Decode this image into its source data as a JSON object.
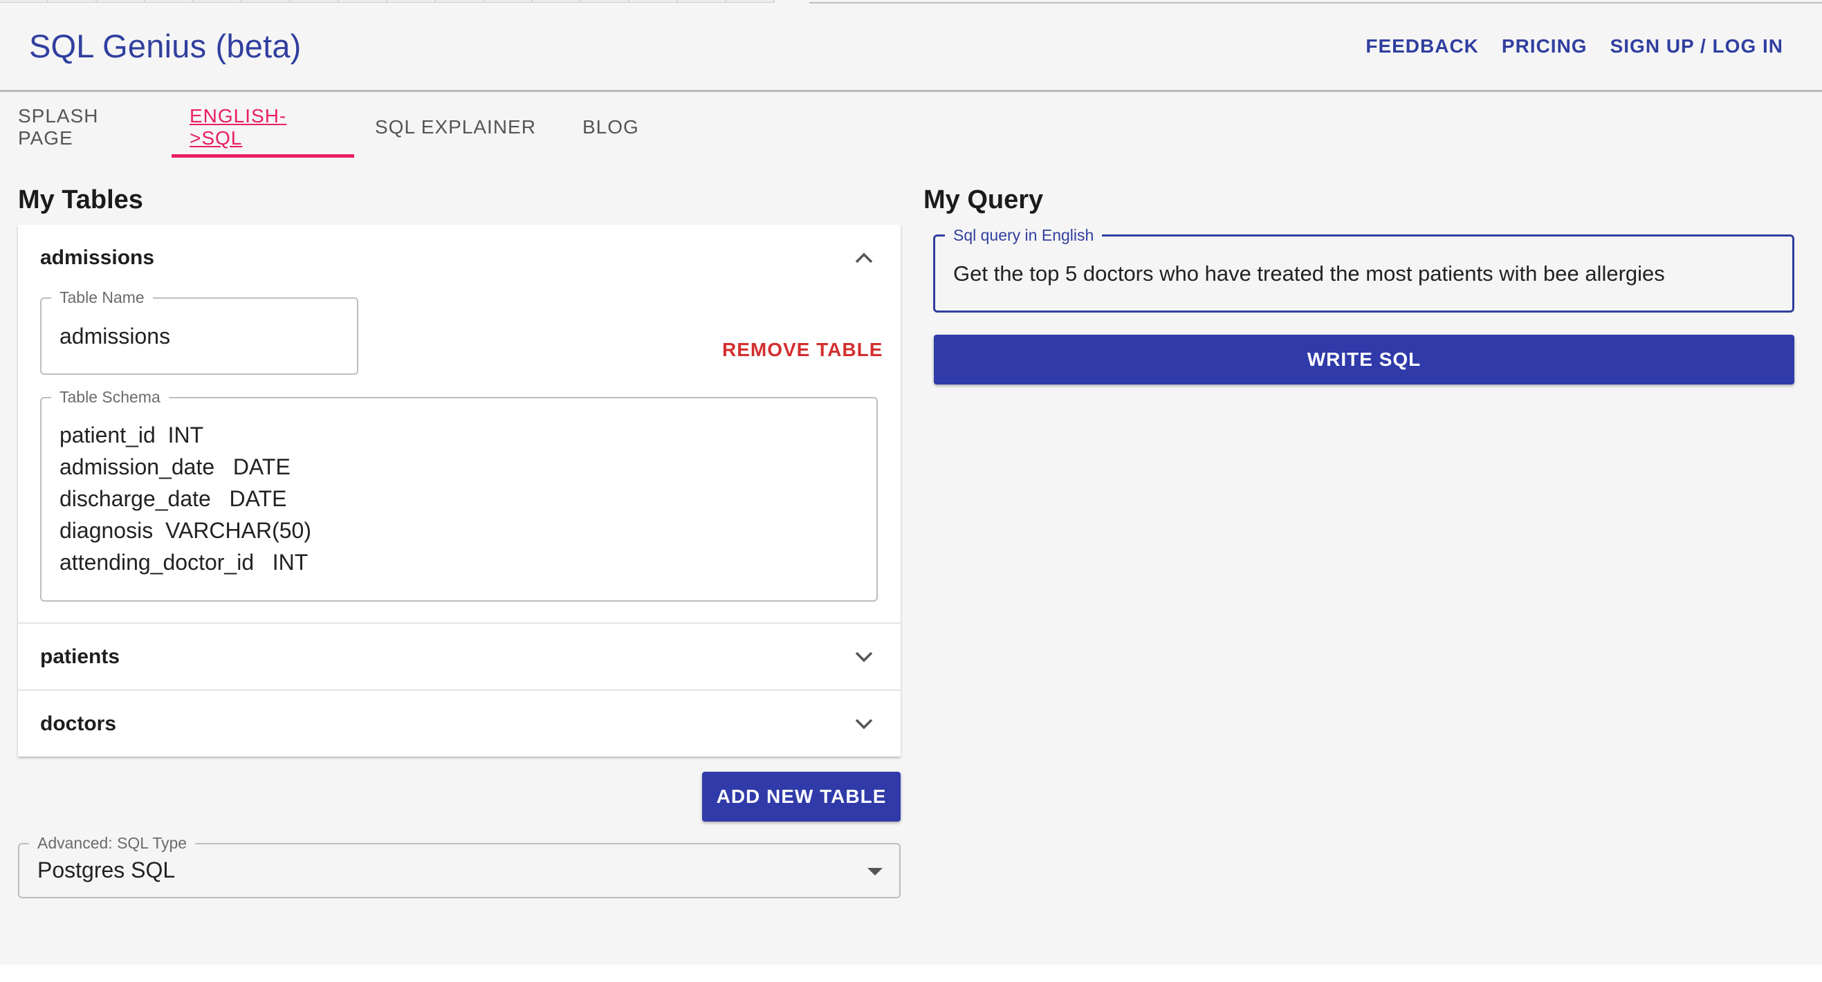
{
  "app": {
    "title": "SQL Genius (beta)"
  },
  "header_nav": [
    {
      "label": "FEEDBACK"
    },
    {
      "label": "PRICING"
    },
    {
      "label": "SIGN UP / LOG IN"
    }
  ],
  "tabs": [
    {
      "label": "SPLASH PAGE",
      "active": false
    },
    {
      "label": "ENGLISH->SQL",
      "active": true
    },
    {
      "label": "SQL EXPLAINER",
      "active": false
    },
    {
      "label": "BLOG",
      "active": false
    }
  ],
  "tables_section": {
    "title": "My Tables",
    "tables": [
      {
        "name": "admissions",
        "expanded": true,
        "name_field_label": "Table Name",
        "name_value": "admissions",
        "remove_label": "REMOVE TABLE",
        "schema_field_label": "Table Schema",
        "schema_lines": [
          "patient_id  INT",
          "admission_date   DATE",
          "discharge_date   DATE",
          "diagnosis  VARCHAR(50)",
          "attending_doctor_id   INT"
        ]
      },
      {
        "name": "patients",
        "expanded": false
      },
      {
        "name": "doctors",
        "expanded": false
      }
    ],
    "add_table_label": "ADD NEW TABLE",
    "sql_type": {
      "label": "Advanced: SQL Type",
      "value": "Postgres SQL"
    }
  },
  "query_section": {
    "title": "My Query",
    "field_label": "Sql query in English",
    "field_value": "Get the top 5 doctors who have treated the most patients with bee allergies",
    "write_button_label": "WRITE SQL"
  },
  "colors": {
    "brand": "#303f9f",
    "primary_button": "#303aa9",
    "active_tab": "#e91e63",
    "danger": "#d32f2f",
    "background": "#f5f5f5"
  },
  "icons": {
    "expanded": "chevron-up-icon",
    "collapsed": "chevron-down-icon",
    "select": "caret-down-icon"
  }
}
